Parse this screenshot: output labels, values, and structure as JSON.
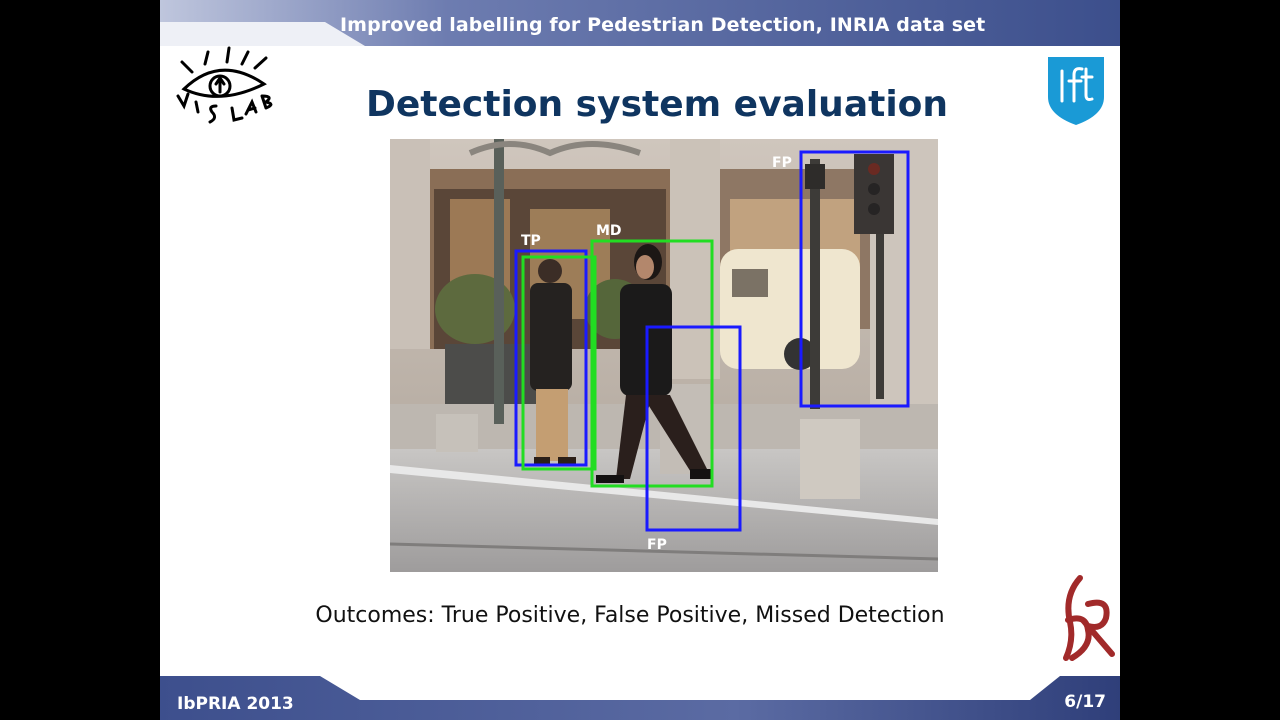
{
  "header": {
    "title": "Improved labelling for Pedestrian Detection, INRIA data set"
  },
  "slide": {
    "title": "Detection system evaluation",
    "caption": "Outcomes: True Positive, False Positive, Missed Detection"
  },
  "photo": {
    "labels": {
      "tp": "TP",
      "md": "MD",
      "fp_top": "FP",
      "fp_bottom": "FP"
    }
  },
  "logos": {
    "vislab": "VISLAB",
    "ist": "IST",
    "isr": "ISR"
  },
  "footer": {
    "conference": "IbPRIA 2013",
    "page": "6/17"
  },
  "colors": {
    "band": "#4d5f9a",
    "title": "#0f3560",
    "box_blue": "#1a1aff",
    "box_green": "#22dd22"
  }
}
